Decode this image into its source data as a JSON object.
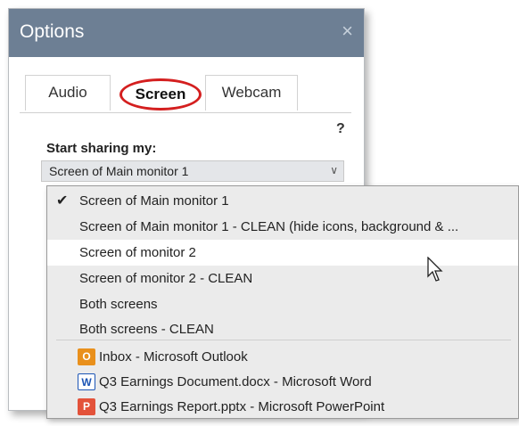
{
  "window": {
    "title": "Options",
    "close_glyph": "×"
  },
  "tabs": [
    {
      "label": "Audio"
    },
    {
      "label": "Screen"
    },
    {
      "label": "Webcam"
    }
  ],
  "help_glyph": "?",
  "sharing": {
    "label": "Start sharing my:",
    "selected_value": "Screen of Main monitor 1",
    "chevron_glyph": "∨"
  },
  "dropdown": {
    "check_glyph": "✔",
    "options": [
      "Screen of Main monitor 1",
      "Screen of Main monitor 1 - CLEAN (hide icons, background & ...",
      "Screen of monitor 2",
      "Screen of monitor 2 - CLEAN",
      "Both screens",
      "Both screens - CLEAN"
    ],
    "apps": [
      {
        "label": "Inbox - Microsoft Outlook",
        "icon": "outlook-icon",
        "glyph": "O"
      },
      {
        "label": "Q3 Earnings Document.docx - Microsoft Word",
        "icon": "word-icon",
        "glyph": "W"
      },
      {
        "label": "Q3 Earnings Report.pptx - Microsoft PowerPoint",
        "icon": "powerpoint-icon",
        "glyph": "P"
      }
    ]
  },
  "colors": {
    "titlebar": "#6d7f94",
    "highlight_circle": "#d41f1f",
    "dropdown_bg": "#ebebeb",
    "hovered_row": "#ffffff"
  }
}
